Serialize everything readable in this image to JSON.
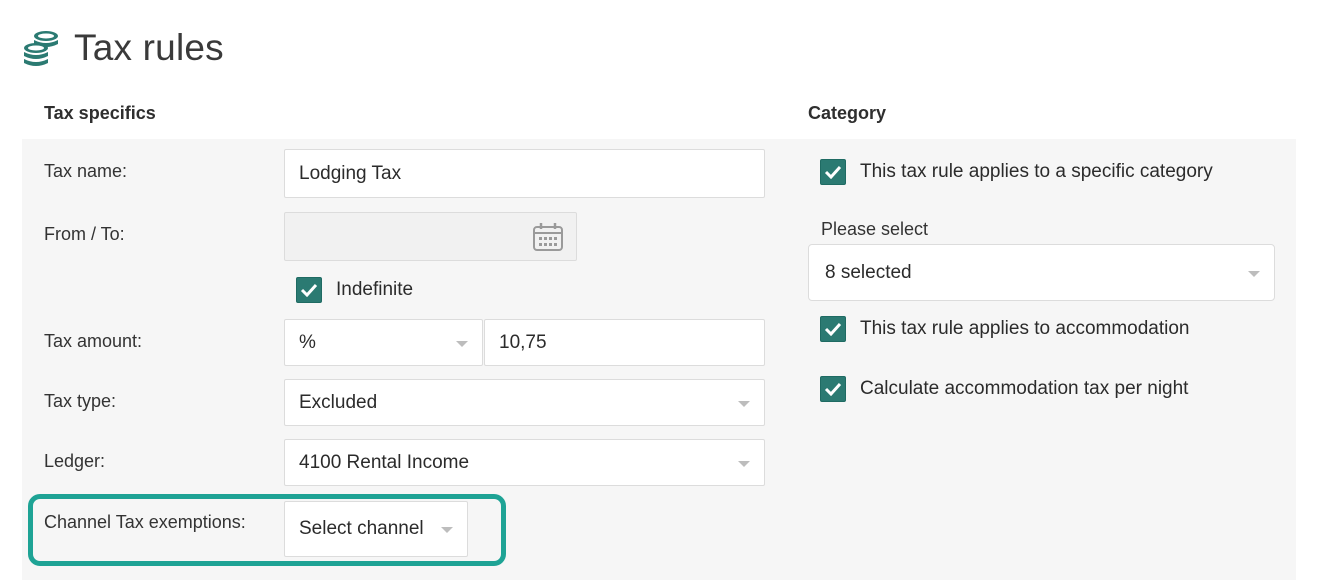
{
  "page": {
    "title": "Tax rules",
    "icon": "coins-stack-icon",
    "accent_color": "#2b7a72",
    "highlight_color": "#1ea395"
  },
  "tax_specifics": {
    "heading": "Tax specifics",
    "tax_name": {
      "label": "Tax name:",
      "value": "Lodging Tax"
    },
    "from_to": {
      "label": "From / To:",
      "value": "",
      "icon": "calendar-icon"
    },
    "indefinite": {
      "label": "Indefinite",
      "checked": true
    },
    "tax_amount": {
      "label": "Tax amount:",
      "unit": "%",
      "value": "10,75"
    },
    "tax_type": {
      "label": "Tax type:",
      "value": "Excluded"
    },
    "ledger": {
      "label": "Ledger:",
      "value": "4100 Rental Income"
    },
    "channel_exemptions": {
      "label": "Channel Tax exemptions:",
      "value": "Select channel"
    }
  },
  "category": {
    "heading": "Category",
    "specific_category": {
      "label": "This tax rule applies to a specific category",
      "checked": true
    },
    "please_select": {
      "label": "Please select",
      "value": "8 selected"
    },
    "applies_accommodation": {
      "label": "This tax rule applies to accommodation",
      "checked": true
    },
    "per_night": {
      "label": "Calculate accommodation tax per night",
      "checked": true
    }
  }
}
